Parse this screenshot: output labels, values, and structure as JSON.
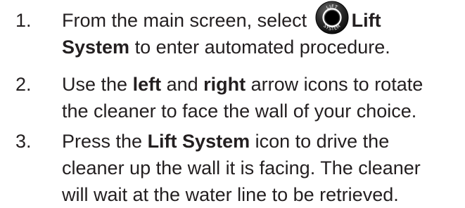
{
  "icons": {
    "lift_system_icon": "lift-system-icon",
    "lift_system_icon_top_text": "LIFT",
    "lift_system_icon_bottom_text": "SYSTEM"
  },
  "steps": [
    {
      "number": "1.",
      "line1_pre": "From the main screen, select ",
      "line1_bold": "Lift",
      "line2_bold": "System",
      "line2_post": " to enter automated procedure."
    },
    {
      "number": "2.",
      "line1_pre": "Use the ",
      "line1_bold1": "left",
      "line1_mid": " and ",
      "line1_bold2": "right",
      "line1_post": " arrow icons to rotate",
      "line2": "the cleaner to face the wall of your choice."
    },
    {
      "number": "3.",
      "line1_pre": "Press the ",
      "line1_bold": "Lift System",
      "line1_post": " icon to drive the",
      "line2": "cleaner up the wall it is facing. The cleaner",
      "line3": "will wait at the water line to be retrieved."
    }
  ],
  "colors": {
    "text": "#231f20",
    "icon_outer": "#1a1a1a",
    "icon_ring": "#ffffff",
    "icon_inner": "#000000"
  }
}
